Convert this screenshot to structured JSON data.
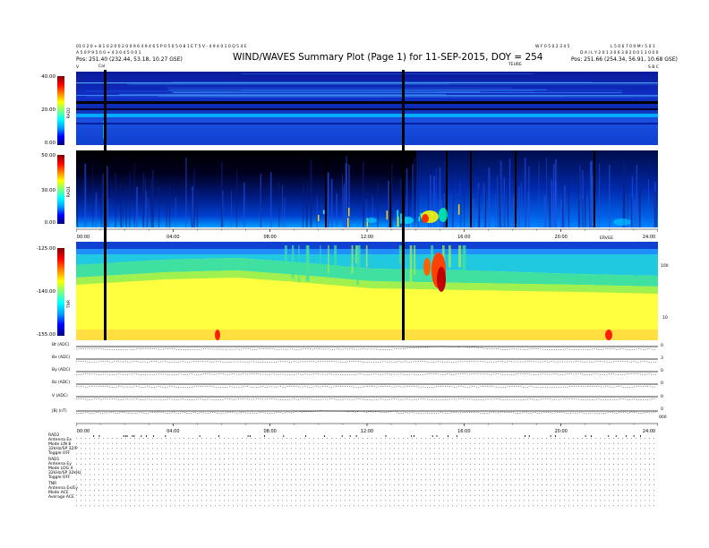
{
  "header": {
    "left_line1": "01 0 2 0 + 8 1 0 2 0 0 2 0 0 9 6 4 9 4 6 5 P 0 5 0 5 0 8 1 E T 5 V - 4 9 4 0 1 0 Q 5 4 E",
    "left_line2": "A 5 0 P 9 5 0 0 + 4 3 0 4 5 0 0 1",
    "left_line3": "Pos:  251.40 (232.44, 53.18, 10.27 GSE)",
    "right_line1": "L 5 0 6 7 0 0 M r 5 0 1",
    "right_line2": "D A I L Y  2 0 1 3 0 6 3 8 2 0 0 1 3 0 0 0",
    "right_line3": "Pos:  251.66 (254.34, 56.91, 10.68 GSE)",
    "center_small": "W F 0 5 0 2 3 4 5",
    "title": "WIND/WAVES Summary Plot (Page 1) for 11-SEP-2015, DOY = 254",
    "top_left_marker": "V",
    "top_cal_marker": "Cal",
    "top_right_label": "TEURE",
    "top_right_small": "S B C"
  },
  "panels": {
    "rad2_label": "RAD2",
    "rad2_ticks": [
      "40.00",
      "20.00",
      "0.00"
    ],
    "rad1_label": "RAD1",
    "rad1_ticks": [
      "50.00",
      "30.00",
      "0.00"
    ],
    "tnr_label": "TNR",
    "tnr_ticks": [
      "-125.00",
      "-140.00",
      "-155.00"
    ],
    "tnr_right_ticks": [
      "100",
      "10"
    ],
    "tnr_right_top": "ERVGE",
    "time_ticks": [
      "00:00",
      "04:00",
      "08:00",
      "12:00",
      "16:00",
      "20:00",
      "24:00"
    ],
    "line_labels": [
      "Bt (ADC)",
      "Bx (ADC)",
      "By (ADC)",
      "Bz (ADC)",
      "V (ADC)",
      "|B| (nT)"
    ],
    "line_right_ticks": [
      "0",
      "3",
      "0",
      "0",
      "0",
      "0",
      "000"
    ]
  },
  "footer": {
    "rad2_block": [
      "RAD2",
      "Antenna   Ex",
      "Mode   LIN 8",
      "32kHz/SP  32/P",
      "Toggle   OFF"
    ],
    "rad1_block": [
      "RAD1",
      "Antenna   Ey",
      "Mode   LOG 4",
      "32kHz/SP  32kHz",
      "Toggle   OFF"
    ],
    "tnr_block": [
      "TNR",
      "Antenna   Ex/Ey",
      "Mode   ACE",
      "Average   ACE"
    ]
  },
  "chart_data": {
    "type": "heatmap",
    "title": "WIND/WAVES Summary Plot (Page 1) for 11-SEP-2015, DOY = 254",
    "xlabel": "",
    "x_range": [
      "00:00",
      "24:00"
    ],
    "x_ticks": [
      "00:00",
      "04:00",
      "08:00",
      "12:00",
      "16:00",
      "20:00",
      "24:00"
    ],
    "panels": [
      {
        "name": "RAD2",
        "y_ticks": [
          0,
          20,
          40
        ],
        "ylim": [
          0,
          40
        ]
      },
      {
        "name": "RAD1",
        "y_ticks": [
          0,
          30,
          50
        ],
        "ylim": [
          0,
          50
        ]
      },
      {
        "name": "TNR",
        "y_ticks": [
          -155,
          -140,
          -125
        ],
        "ylim": [
          -155,
          -125
        ],
        "right_ticks": [
          10,
          100
        ]
      }
    ],
    "data_gaps_hours": [
      1.2,
      13.5
    ],
    "colormap": [
      "#000080",
      "#0000ff",
      "#00ffff",
      "#00ff00",
      "#ffff00",
      "#ff8000",
      "#ff0000",
      "#800000"
    ]
  }
}
